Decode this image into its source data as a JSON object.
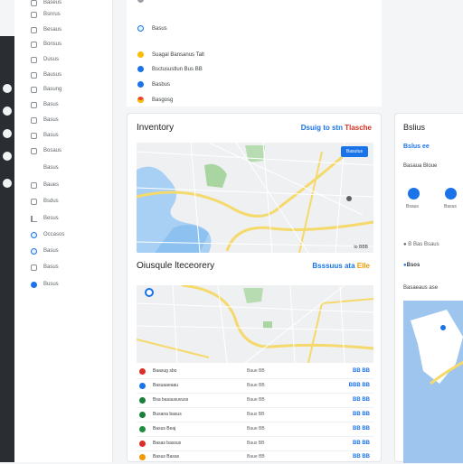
{
  "sidebar": {
    "items": [
      {
        "label": "Baseus",
        "icon": "doc-icon"
      },
      {
        "label": "Bsnrus",
        "icon": "doc-icon"
      },
      {
        "label": "Besaus",
        "icon": "doc-icon"
      },
      {
        "label": "Bonsus",
        "icon": "doc-icon"
      },
      {
        "label": "Dusus",
        "icon": "doc-icon"
      },
      {
        "label": "Bausus",
        "icon": "doc-icon"
      },
      {
        "label": "Basung",
        "icon": "doc-icon"
      },
      {
        "label": "Basus",
        "icon": "doc-icon"
      },
      {
        "label": "Basus",
        "icon": "doc-icon"
      },
      {
        "label": "Basus",
        "icon": "doc-icon"
      },
      {
        "label": "Bosaus",
        "icon": "none"
      },
      {
        "label": "Basus",
        "icon": "doc-icon",
        "chevron": "›"
      },
      {
        "label": "Baues",
        "icon": "doc-icon"
      },
      {
        "label": "Bsdus",
        "icon": "chart-icon"
      },
      {
        "label": "Besus",
        "icon": "circle-icon"
      },
      {
        "label": "Occasos",
        "icon": "circle-icon"
      },
      {
        "label": "Basus",
        "icon": "doc-icon"
      },
      {
        "label": "Basus",
        "icon": "doc-icon"
      },
      {
        "label": "Busus",
        "icon": "circle-icon"
      }
    ]
  },
  "top_list": [
    {
      "label": "Basus",
      "color": "#1a73e8"
    },
    {
      "label": "Suagal Bansanus Talt",
      "color": "#fbbc04"
    },
    {
      "label": "Bsctusustlun Bus BB",
      "color": "#1a73e8"
    },
    {
      "label": "Basbus",
      "color": "#1a73e8"
    },
    {
      "label": "Basgosg",
      "color": "#ea4335"
    }
  ],
  "inventory": {
    "title": "Inventory",
    "link_blue": "Dsuig to stn",
    "link_red": "Tlasche",
    "map_button": "Basutus",
    "map_caption": "to BBB"
  },
  "overview": {
    "title": "Oiusqule lteceorery",
    "link_blue": "Bsssuus ata",
    "link_yellow": "Elle"
  },
  "rows": [
    {
      "name": "Baasug sbo",
      "mid": "Baue BB",
      "value": "BB BB",
      "color": "#d93025"
    },
    {
      "name": "Basuaaeaau",
      "mid": "Baue BB",
      "value": "BBB BB",
      "color": "#1a73e8"
    },
    {
      "name": "Bsa basausuvuss",
      "mid": "Baue BB",
      "value": "BB BB",
      "color": "#188038"
    },
    {
      "name": "Busana basus",
      "mid": "Baus BB",
      "value": "BB BB",
      "color": "#188038"
    },
    {
      "name": "Basus Beaj",
      "mid": "Baue BB",
      "value": "BB BB",
      "color": "#1e8e3e"
    },
    {
      "name": "Basas bassus",
      "mid": "Baus BB",
      "value": "BB BB",
      "color": "#d93025"
    },
    {
      "name": "Basus Basas",
      "mid": "Baue BB",
      "value": "BB BB",
      "color": "#f29900"
    }
  ],
  "right_panel": {
    "title": "Bslius",
    "link": "Bslus ee",
    "subtitle": "Basaua Bloue",
    "action1": "Bsaus",
    "action2": "Basus",
    "row_text": "B Bas Bsaus",
    "tag": "Bsos",
    "section": "Basaeaus ase"
  }
}
